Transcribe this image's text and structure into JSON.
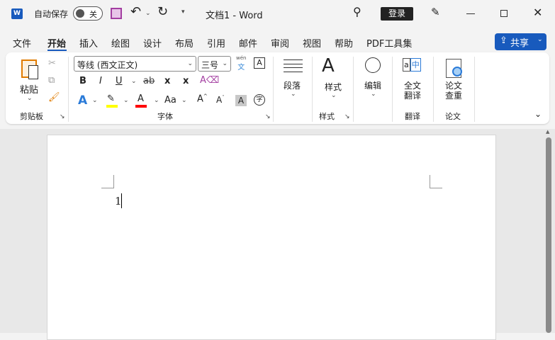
{
  "titlebar": {
    "autosave_label": "自动保存",
    "autosave_state": "关",
    "title": "文档1  -  Word",
    "login": "登录"
  },
  "tabs": [
    "文件",
    "开始",
    "插入",
    "绘图",
    "设计",
    "布局",
    "引用",
    "邮件",
    "审阅",
    "视图",
    "帮助",
    "PDF工具集"
  ],
  "active_tab": "开始",
  "share": {
    "label": "共享"
  },
  "clipboard": {
    "paste": "粘贴",
    "group": "剪贴板"
  },
  "font": {
    "name": "等线 (西文正文)",
    "size": "三号",
    "group": "字体",
    "wen": "wén",
    "wen_char": "文",
    "bold": "B",
    "italic": "I",
    "underline": "U",
    "strike": "ab",
    "sub": "x",
    "sup": "x",
    "grow": "A",
    "shrink": "A",
    "case": "Aa",
    "shade": "A",
    "enclose": "字",
    "font_a": "A",
    "box_a": "A"
  },
  "paragraph": {
    "label": "段落"
  },
  "styles": {
    "label": "样式",
    "group": "样式"
  },
  "editing": {
    "label": "编辑"
  },
  "translate": {
    "label1": "全文",
    "label2": "翻译",
    "group": "翻译"
  },
  "paper": {
    "label1": "论文",
    "label2": "查重",
    "group": "论文"
  },
  "document": {
    "text": "1"
  },
  "colors": {
    "accent": "#185abd",
    "highlight": "#ffff00",
    "font_color": "#ff0000"
  }
}
